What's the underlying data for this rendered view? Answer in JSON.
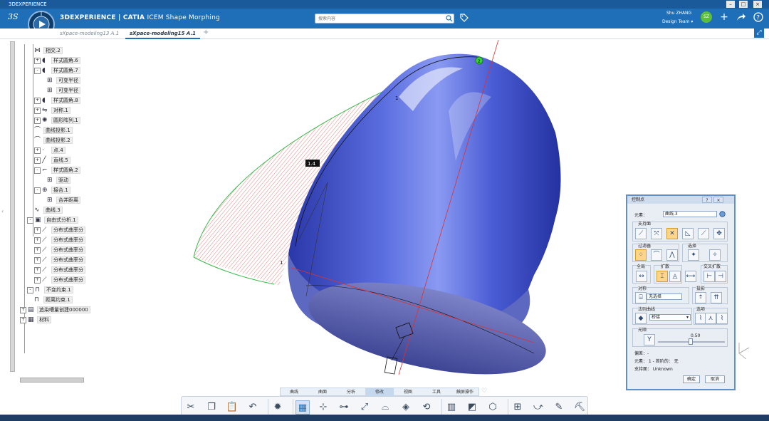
{
  "os_window": {
    "title": "3DEXPERIENCE"
  },
  "header": {
    "brand_bold": "3DEXPERIENCE | CATIA",
    "brand_light": "ICEM Shape Morphing",
    "search_placeholder": "搜索内容",
    "user_name": "Shu ZHANG",
    "user_team": "Design Team",
    "avatar_text": "SZ",
    "icons": [
      "search-icon",
      "tag-icon",
      "plus-icon",
      "share-icon",
      "help-icon"
    ]
  },
  "tabs": [
    {
      "label": "sXpace-modeling13 A.1",
      "active": false
    },
    {
      "label": "sXpace-modeling15 A.1",
      "active": true
    }
  ],
  "tree": [
    {
      "label": "相交.2",
      "depth": 1,
      "pm": "",
      "icon": "intersect"
    },
    {
      "label": "样式圆角.6",
      "depth": 1,
      "pm": "+",
      "icon": "fillet"
    },
    {
      "label": "样式圆角.7",
      "depth": 1,
      "pm": "-",
      "icon": "fillet"
    },
    {
      "label": "可变半径",
      "depth": 2,
      "pm": "",
      "icon": "param"
    },
    {
      "label": "可变半径",
      "depth": 2,
      "pm": "",
      "icon": "param"
    },
    {
      "label": "样式圆角.8",
      "depth": 1,
      "pm": "+",
      "icon": "fillet"
    },
    {
      "label": "对称.1",
      "depth": 1,
      "pm": "+",
      "icon": "sym"
    },
    {
      "label": "圆形阵列.1",
      "depth": 1,
      "pm": "+",
      "icon": "pattern"
    },
    {
      "label": "曲线投影.1",
      "depth": 1,
      "pm": "",
      "icon": "proj"
    },
    {
      "label": "曲线投影.2",
      "depth": 1,
      "pm": "",
      "icon": "proj"
    },
    {
      "label": "点.4",
      "depth": 1,
      "pm": "+",
      "icon": "point"
    },
    {
      "label": "直线.5",
      "depth": 1,
      "pm": "+",
      "icon": "line"
    },
    {
      "label": "样式圆角.2",
      "depth": 1,
      "pm": "-",
      "icon": "fillet2"
    },
    {
      "label": "驱动",
      "depth": 2,
      "pm": "",
      "icon": "param"
    },
    {
      "label": "接合.1",
      "depth": 1,
      "pm": "-",
      "icon": "join"
    },
    {
      "label": "合并距离",
      "depth": 2,
      "pm": "",
      "icon": "param"
    },
    {
      "label": "曲线.3",
      "depth": 1,
      "pm": "",
      "icon": "curve"
    },
    {
      "label": "自由式分析.1",
      "depth": 0,
      "pm": "-",
      "icon": "analysis"
    },
    {
      "label": "分布式曲率分",
      "depth": 1,
      "pm": "+",
      "icon": "curv"
    },
    {
      "label": "分布式曲率分",
      "depth": 1,
      "pm": "+",
      "icon": "curv"
    },
    {
      "label": "分布式曲率分",
      "depth": 1,
      "pm": "+",
      "icon": "curv"
    },
    {
      "label": "分布式曲率分",
      "depth": 1,
      "pm": "+",
      "icon": "curv"
    },
    {
      "label": "分布式曲率分",
      "depth": 1,
      "pm": "+",
      "icon": "curv"
    },
    {
      "label": "分布式曲率分",
      "depth": 1,
      "pm": "+",
      "icon": "curv"
    },
    {
      "label": "不变约束.1",
      "depth": 0,
      "pm": "-",
      "icon": "constraint"
    },
    {
      "label": "距离约束.1",
      "depth": 1,
      "pm": "",
      "icon": "constraint2"
    },
    {
      "label": "追染嘈量创建000000",
      "depth": -1,
      "pm": "+",
      "icon": "body"
    },
    {
      "label": "材料",
      "depth": -1,
      "pm": "+",
      "icon": "material"
    }
  ],
  "viewport": {
    "label_point": "2",
    "label_tag": "1.4",
    "label_side1": "1",
    "label_side2": "1"
  },
  "section_tabs": [
    {
      "label": "曲线",
      "active": false
    },
    {
      "label": "曲面",
      "active": false
    },
    {
      "label": "分析",
      "active": false
    },
    {
      "label": "修改",
      "active": true
    },
    {
      "label": "视图",
      "active": false
    },
    {
      "label": "工具",
      "active": false
    },
    {
      "label": "触屏操作",
      "active": false
    }
  ],
  "toolbar_icons": [
    "cut-icon",
    "copy-icon",
    "paste-icon",
    "undo-icon",
    "settings-icon",
    "control-points-icon",
    "modify-icon",
    "match-icon",
    "align-icon",
    "fillet-icon",
    "shape-icon",
    "morph-icon",
    "grid-icon",
    "map-icon",
    "deform-icon",
    "array-icon",
    "curve-icon",
    "edit-icon",
    "tool-icon"
  ],
  "dialog": {
    "title": "控制点",
    "element_label": "元素：",
    "element_value": "曲线.3",
    "group_support": "支持面",
    "group_filter": "过滤器",
    "group_select": "选择",
    "group_full": "全局",
    "group_spread": "扩散",
    "group_cross": "交叉扩散",
    "group_sym": "对称",
    "sym_value": "无选择",
    "group_proj": "投影",
    "group_law": "法则曲线",
    "law_value": "桥接",
    "group_options": "选项",
    "group_light": "光顺",
    "light_value": "0.50",
    "tolerance_label": "偏差：-",
    "element_info": "元素：  1 - 首阶的： 无",
    "support_info": "支持面： Unknown",
    "ok_label": "确定",
    "cancel_label": "取消"
  },
  "colors": {
    "header": "#1e6fb8",
    "surface": "#3d4fc6",
    "dialog_border": "#5f8fc4"
  }
}
